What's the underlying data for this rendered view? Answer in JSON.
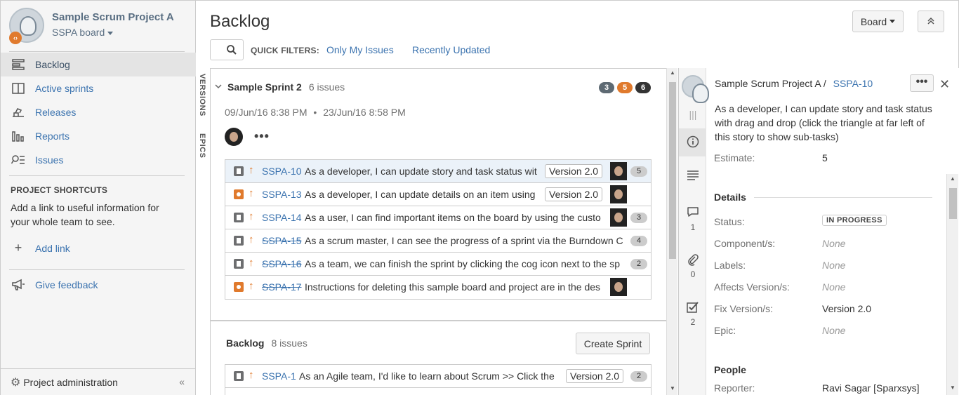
{
  "project": {
    "name": "Sample Scrum Project A",
    "board": "SSPA board"
  },
  "sidebar": {
    "nav": [
      {
        "label": "Backlog",
        "icon": "backlog-icon",
        "active": true
      },
      {
        "label": "Active sprints",
        "icon": "active-sprints-icon",
        "active": false
      },
      {
        "label": "Releases",
        "icon": "releases-icon",
        "active": false
      },
      {
        "label": "Reports",
        "icon": "reports-icon",
        "active": false
      },
      {
        "label": "Issues",
        "icon": "issues-icon",
        "active": false
      }
    ],
    "shortcuts_title": "PROJECT SHORTCUTS",
    "shortcuts_text": "Add a link to useful information for your whole team to see.",
    "add_link": "Add link",
    "feedback": "Give feedback",
    "admin": "Project administration",
    "collapse": "«"
  },
  "header": {
    "title": "Backlog",
    "board_button": "Board",
    "quick_filters_label": "QUICK FILTERS:",
    "filters": [
      "Only My Issues",
      "Recently Updated"
    ]
  },
  "vtabs": [
    "VERSIONS",
    "EPICS"
  ],
  "sprint": {
    "name": "Sample Sprint 2",
    "count": "6 issues",
    "badges": [
      {
        "value": "3",
        "color": "#5e6a73"
      },
      {
        "value": "5",
        "color": "#e07a2d"
      },
      {
        "value": "6",
        "color": "#333333"
      }
    ],
    "start": "09/Jun/16 8:38 PM",
    "end": "23/Jun/16 8:58 PM",
    "dot": "•",
    "more": "•••",
    "issues": [
      {
        "type": "story",
        "key": "SSPA-10",
        "done": false,
        "summary": "As a developer, I can update story and task status wit",
        "version": "Version 2.0",
        "estimate": "5",
        "selected": true
      },
      {
        "type": "task",
        "key": "SSPA-13",
        "done": false,
        "summary": "As a developer, I can update details on an item using",
        "version": "Version 2.0",
        "estimate": "",
        "selected": false
      },
      {
        "type": "story",
        "key": "SSPA-14",
        "done": false,
        "summary": "As a user, I can find important items on the board by using the custo",
        "version": "",
        "estimate": "3",
        "selected": false
      },
      {
        "type": "story",
        "key": "SSPA-15",
        "done": true,
        "summary": "As a scrum master, I can see the progress of a sprint via the Burndown C",
        "version": "",
        "estimate": "4",
        "selected": false
      },
      {
        "type": "story",
        "key": "SSPA-16",
        "done": true,
        "summary": "As a team, we can finish the sprint by clicking the cog icon next to the sp",
        "version": "",
        "estimate": "2",
        "selected": false
      },
      {
        "type": "task",
        "key": "SSPA-17",
        "done": true,
        "summary": "Instructions for deleting this sample board and project are in the des",
        "version": "",
        "estimate": "",
        "selected": false
      }
    ]
  },
  "backlog": {
    "name": "Backlog",
    "count": "8 issues",
    "create_sprint": "Create Sprint",
    "issues": [
      {
        "type": "story",
        "key": "SSPA-1",
        "done": false,
        "summary": "As an Agile team, I'd like to learn about Scrum >> Click the",
        "version": "Version 2.0",
        "estimate": "2"
      }
    ]
  },
  "detail": {
    "project": "Sample Scrum Project A",
    "slash": "/",
    "key": "SSPA-10",
    "more": "•••",
    "close": "✕",
    "summary": "As a developer, I can update story and task status with drag and drop (click the triangle at far left of this story to show sub-tasks)",
    "estimate_label": "Estimate:",
    "estimate": "5",
    "details_title": "Details",
    "fields": [
      {
        "label": "Status:",
        "value": "IN PROGRESS"
      },
      {
        "label": "Component/s:",
        "value": "None"
      },
      {
        "label": "Labels:",
        "value": "None"
      },
      {
        "label": "Affects Version/s:",
        "value": "None"
      },
      {
        "label": "Fix Version/s:",
        "value": "Version 2.0"
      },
      {
        "label": "Epic:",
        "value": "None"
      }
    ],
    "people_title": "People",
    "reporter_label": "Reporter:",
    "reporter": "Ravi Sagar [Sparxsys]",
    "strip_counts": {
      "comments": "1",
      "attachments": "0",
      "subtasks": "2"
    }
  }
}
